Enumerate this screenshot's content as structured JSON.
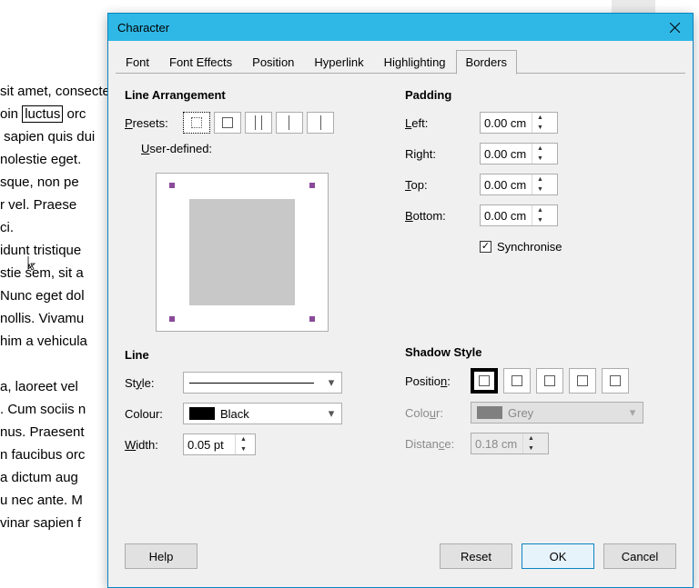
{
  "bg_doc": {
    "lines": [
      "sit amet, consectetur",
      "oin luctus orci ac",
      "sapien quis dui",
      "nolestie eget.",
      "sque, non pellent",
      "r vel. Praesent",
      "ci.",
      "idunt tristique",
      "stie sem, sit amet",
      "Nunc eget dolor",
      "nollis. Vivamus",
      "him a vehicula",
      "",
      "a, laoreet vel",
      ". Cum sociis natoque",
      "nus. Praesent",
      "n faucibus orci",
      "a dictum aug",
      "u nec ante. M",
      "vinar sapien f"
    ],
    "boxed_word": "luctus"
  },
  "dialog": {
    "title": "Character",
    "tabs": [
      "Font",
      "Font Effects",
      "Position",
      "Hyperlink",
      "Highlighting",
      "Borders"
    ],
    "active_tab": 5,
    "line_arrangement_title": "Line Arrangement",
    "presets_label": "Presets:",
    "user_defined_label": "User-defined:",
    "line_title": "Line",
    "style_label": "Style:",
    "colour_label": "Colour:",
    "colour_value": "Black",
    "width_label": "Width:",
    "width_value": "0.05 pt",
    "padding_title": "Padding",
    "padding_left_label": "Left:",
    "padding_right_label": "Right:",
    "padding_top_label": "Top:",
    "padding_bottom_label": "Bottom:",
    "padding_left": "0.00 cm",
    "padding_right": "0.00 cm",
    "padding_top": "0.00 cm",
    "padding_bottom": "0.00 cm",
    "sync_label": "Synchronise",
    "sync_checked": true,
    "shadow_title": "Shadow Style",
    "shadow_position_label": "Position:",
    "shadow_colour_label": "Colour:",
    "shadow_colour_value": "Grey",
    "shadow_distance_label": "Distance:",
    "shadow_distance_value": "0.18 cm",
    "buttons": {
      "help": "Help",
      "reset": "Reset",
      "ok": "OK",
      "cancel": "Cancel"
    }
  }
}
